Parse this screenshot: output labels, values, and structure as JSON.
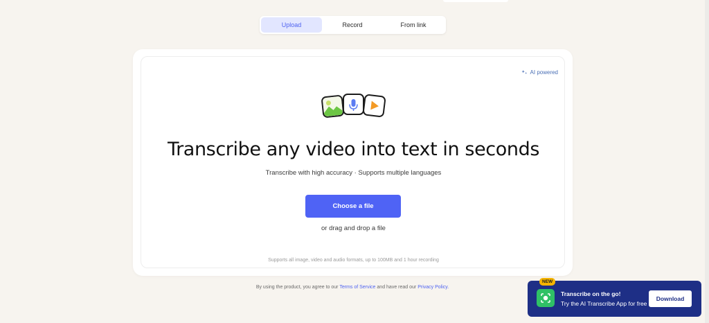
{
  "tabs": [
    {
      "label": "Upload",
      "active": true
    },
    {
      "label": "Record",
      "active": false
    },
    {
      "label": "From link",
      "active": false
    }
  ],
  "badge": {
    "label": "AI powered",
    "icon": "sparkle-icon"
  },
  "media_icons": [
    "image-icon",
    "microphone-icon",
    "play-icon"
  ],
  "hero": {
    "title": "Transcribe any video into text in seconds",
    "subtitle": "Transcribe with high accuracy · Supports multiple languages"
  },
  "upload": {
    "button_label": "Choose a file",
    "drag_text": "or drag and drop a file",
    "supports_text": "Supports all image, video and audio formats, up to 100MB and 1 hour recording"
  },
  "legal": {
    "prefix": "By using the product, you agree to our",
    "terms_link": "Terms of Service",
    "middle": "and have read our",
    "privacy_link": "Privacy Policy."
  },
  "promo": {
    "badge": "NEW",
    "title": "Transcribe on the go!",
    "subtitle": "Try the AI Transcribe App for free",
    "button_label": "Download"
  },
  "colors": {
    "accent": "#4f63f5",
    "background": "#f7f4ef",
    "promo_bg": "#1e2f86",
    "new_badge": "#f5b400",
    "app_icon": "#2fc166"
  }
}
